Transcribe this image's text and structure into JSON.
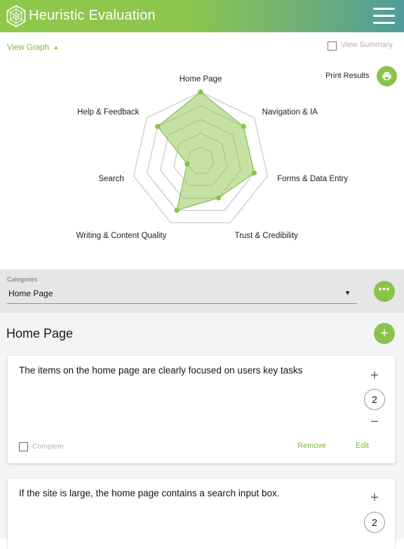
{
  "header": {
    "title": "Heuristic Evaluation",
    "logo_icon": "hexagon-logo-icon",
    "menu_icon": "hamburger-menu-icon"
  },
  "graph_controls": {
    "view_graph_label": "View Graph",
    "view_graph_arrow": "▲",
    "view_summary_label": "View Summary",
    "view_summary_checked": false
  },
  "print": {
    "label": "Print Results",
    "icon": "printer-icon"
  },
  "chart_data": {
    "type": "radar",
    "title": "",
    "axes": [
      "Home Page",
      "Navigation & IA",
      "Forms & Data Entry",
      "Trust & Credibility",
      "Writing & Content Quality",
      "Search",
      "Help & Feedback"
    ],
    "scale_max": 5,
    "rings": 5,
    "values": [
      5,
      4,
      4,
      3,
      4,
      1,
      4
    ],
    "colors": {
      "fill": "#8bc34a",
      "point": "#8bc34a",
      "grid": "#bdbdbd"
    }
  },
  "categories": {
    "caption": "Categories",
    "selected": "Home Page",
    "caret": "▼",
    "more_icon": "more-horizontal-icon",
    "more_label": "•••"
  },
  "section": {
    "title": "Home Page",
    "add_label": "+"
  },
  "cards": [
    {
      "text": "The items on the home page are clearly focused on users key tasks",
      "increment": "+",
      "score": "2",
      "decrement": "−",
      "complete_label": "Complete",
      "complete_checked": false,
      "remove_label": "Remove",
      "edit_label": "Edit"
    },
    {
      "text": "If the site is large, the home page contains a search input box.",
      "increment": "+",
      "score": "2"
    }
  ],
  "colors": {
    "accent": "#8bc34a",
    "header_gradient_start": "#8fc84a",
    "header_gradient_end": "#4f9c9a"
  }
}
